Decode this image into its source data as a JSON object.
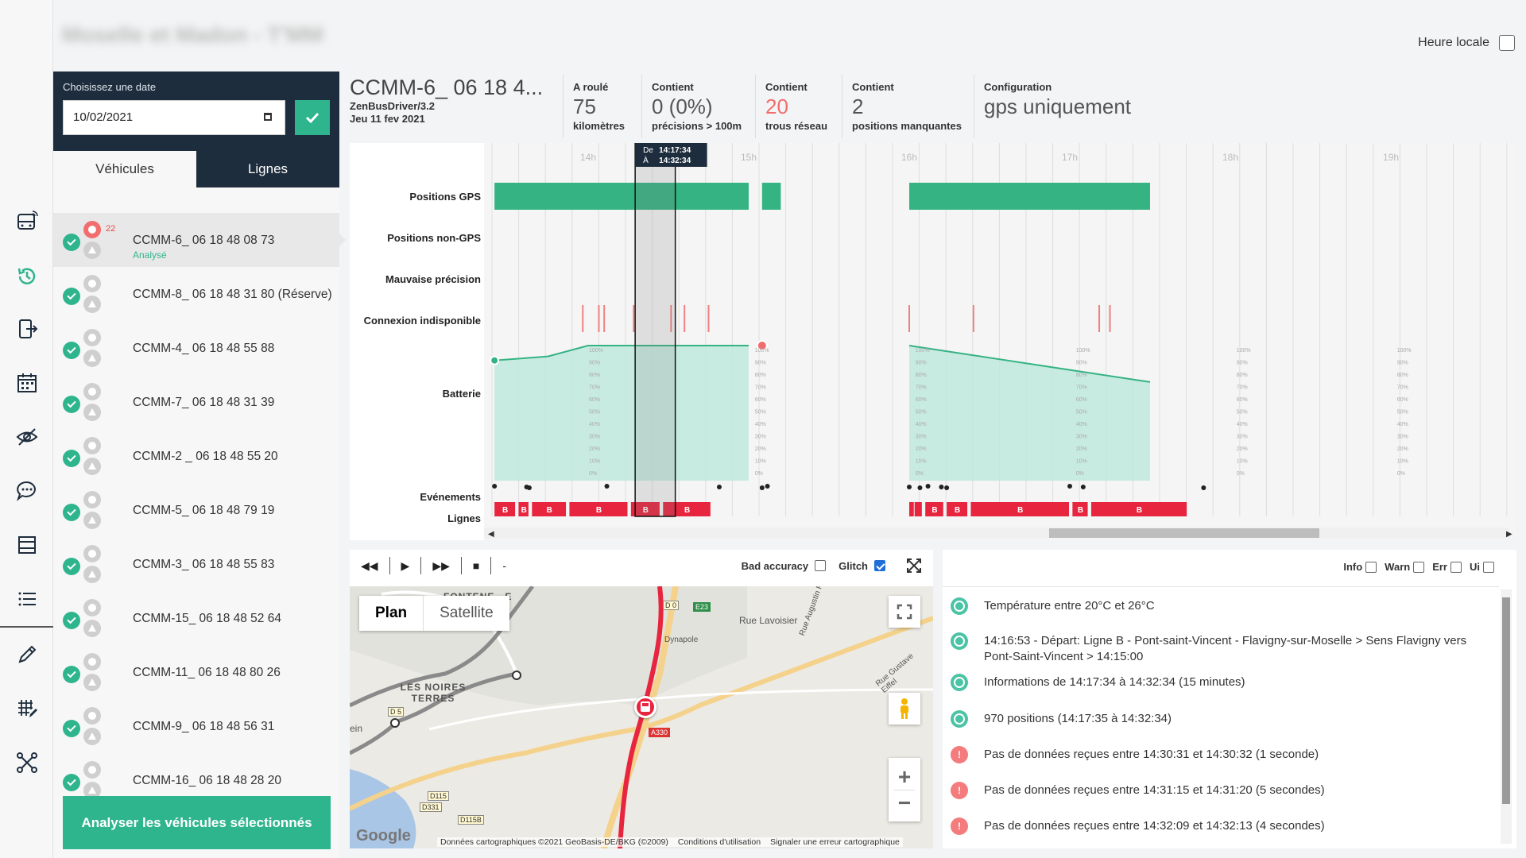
{
  "header": {
    "app_title": "Moselle et Madon - T'MM",
    "local_time_label": "Heure locale"
  },
  "date_picker": {
    "label": "Choisissez une date",
    "value": "10/02/2021"
  },
  "tabs": [
    {
      "label": "Véhicules"
    },
    {
      "label": "Lignes"
    }
  ],
  "vehicles": [
    {
      "name": "CCMM-6_ 06 18 48 08 73",
      "status": "Analysé",
      "error_count": "22"
    },
    {
      "name": "CCMM-8_ 06 18 48 31 80 (Réserve)"
    },
    {
      "name": "CCMM-4_ 06 18 48 55 88"
    },
    {
      "name": "CCMM-7_ 06 18 48 31 39"
    },
    {
      "name": "CCMM-2 _ 06 18 48 55 20"
    },
    {
      "name": "CCMM-5_ 06 18 48 79 19"
    },
    {
      "name": "CCMM-3_ 06 18 48 55 83"
    },
    {
      "name": "CCMM-15_ 06 18 48 52 64"
    },
    {
      "name": "CCMM-11_ 06 18 48 80 26"
    },
    {
      "name": "CCMM-9_ 06 18 48 56 31"
    },
    {
      "name": "CCMM-16_ 06 18 48 28 20"
    }
  ],
  "analyze_button": "Analyser les véhicules sélectionnés",
  "summary": {
    "vehicle_title": "CCMM-6_ 06 18 4...",
    "driver_app": "ZenBusDriver/3.2",
    "date_text": "Jeu 11 fev 2021",
    "stats": [
      {
        "label": "A roulé",
        "value": "75",
        "unit": "kilomètres"
      },
      {
        "label": "Contient",
        "value": "0 (0%)",
        "unit": "précisions > 100m"
      },
      {
        "label": "Contient",
        "value": "20",
        "unit": "trous réseau"
      },
      {
        "label": "Contient",
        "value": "2",
        "unit": "positions manquantes"
      },
      {
        "label": "Configuration",
        "value": "gps uniquement",
        "unit": ""
      }
    ]
  },
  "timeline": {
    "rows": [
      "Positions GPS",
      "Positions non-GPS",
      "Mauvaise précision",
      "Connexion indisponible",
      "Batterie",
      "Evénements",
      "Lignes"
    ],
    "hours": [
      "14h",
      "15h",
      "16h",
      "17h",
      "18h",
      "19h"
    ],
    "selection": {
      "from_label": "De",
      "from": "14:17:34",
      "to_label": "À",
      "to": "14:32:34"
    },
    "line_label": "B",
    "battery_ticks": [
      "100%",
      "90%",
      "80%",
      "70%",
      "60%",
      "50%",
      "40%",
      "30%",
      "20%",
      "10%",
      "0%"
    ],
    "colors": {
      "gps": "#35b383",
      "battery": "#bde8dc",
      "error": "#f08080",
      "line": "#e8253f"
    }
  },
  "chart_data": {
    "type": "area",
    "title": "",
    "xlabel": "",
    "ylabel": "Batterie",
    "ylim": [
      0,
      100
    ],
    "x_ticks": [
      "14h",
      "15h",
      "16h",
      "17h",
      "18h",
      "19h"
    ],
    "series": [
      {
        "name": "Batterie",
        "segments": [
          {
            "x": [
              "13:25",
              "13:45",
              "14:00",
              "15:00"
            ],
            "y": [
              89,
              92,
              100,
              100
            ]
          },
          {
            "x": [
              "16:00",
              "17:00",
              "17:30"
            ],
            "y": [
              100,
              82,
              73
            ]
          }
        ]
      }
    ],
    "gps_coverage": [
      [
        "13:25",
        "15:00"
      ],
      [
        "15:05",
        "15:12"
      ],
      [
        "16:00",
        "17:30"
      ]
    ],
    "selection": [
      "14:17:34",
      "14:32:34"
    ]
  },
  "player": {
    "bad_accuracy_label": "Bad accuracy",
    "glitch_label": "Glitch",
    "separator": "-"
  },
  "map": {
    "tabs": [
      {
        "label": "Plan"
      },
      {
        "label": "Satellite"
      }
    ],
    "places": [
      "FONTENE...E",
      "LES NOIRES TERRES",
      "Rue Lavoisier",
      "Rue Augustin Fresnel",
      "Rue Gustave Eiffel",
      "Dynapole",
      "ein"
    ],
    "roads": [
      "D 0",
      "D 5",
      "E23",
      "A330",
      "D115",
      "D331",
      "D115B"
    ],
    "footer": [
      "Données cartographiques ©2021 GeoBasis-DE/BKG (©2009)",
      "Conditions d'utilisation",
      "Signaler une erreur cartographique"
    ],
    "logo": "Google"
  },
  "log": {
    "filters": [
      {
        "label": "Info"
      },
      {
        "label": "Warn"
      },
      {
        "label": "Err"
      },
      {
        "label": "Ui"
      }
    ],
    "items": [
      {
        "type": "ok",
        "text": "Température entre 20°C et 26°C"
      },
      {
        "type": "ok",
        "text": "14:16:53 - Départ: Ligne B - Pont-saint-Vincent - Flavigny-sur-Moselle > Sens Flavigny vers Pont-Saint-Vincent > 14:15:00"
      },
      {
        "type": "ok",
        "text": "Informations de 14:17:34 à 14:32:34 (15 minutes)"
      },
      {
        "type": "ok",
        "text": "970 positions (14:17:35 à 14:32:34)"
      },
      {
        "type": "err",
        "text": "Pas de données reçues entre 14:30:31 et 14:30:32 (1 seconde)"
      },
      {
        "type": "err",
        "text": "Pas de données reçues entre 14:31:15 et 14:31:20 (5 secondes)"
      },
      {
        "type": "err",
        "text": "Pas de données reçues entre 14:32:09 et 14:32:13 (4 secondes)"
      }
    ]
  }
}
